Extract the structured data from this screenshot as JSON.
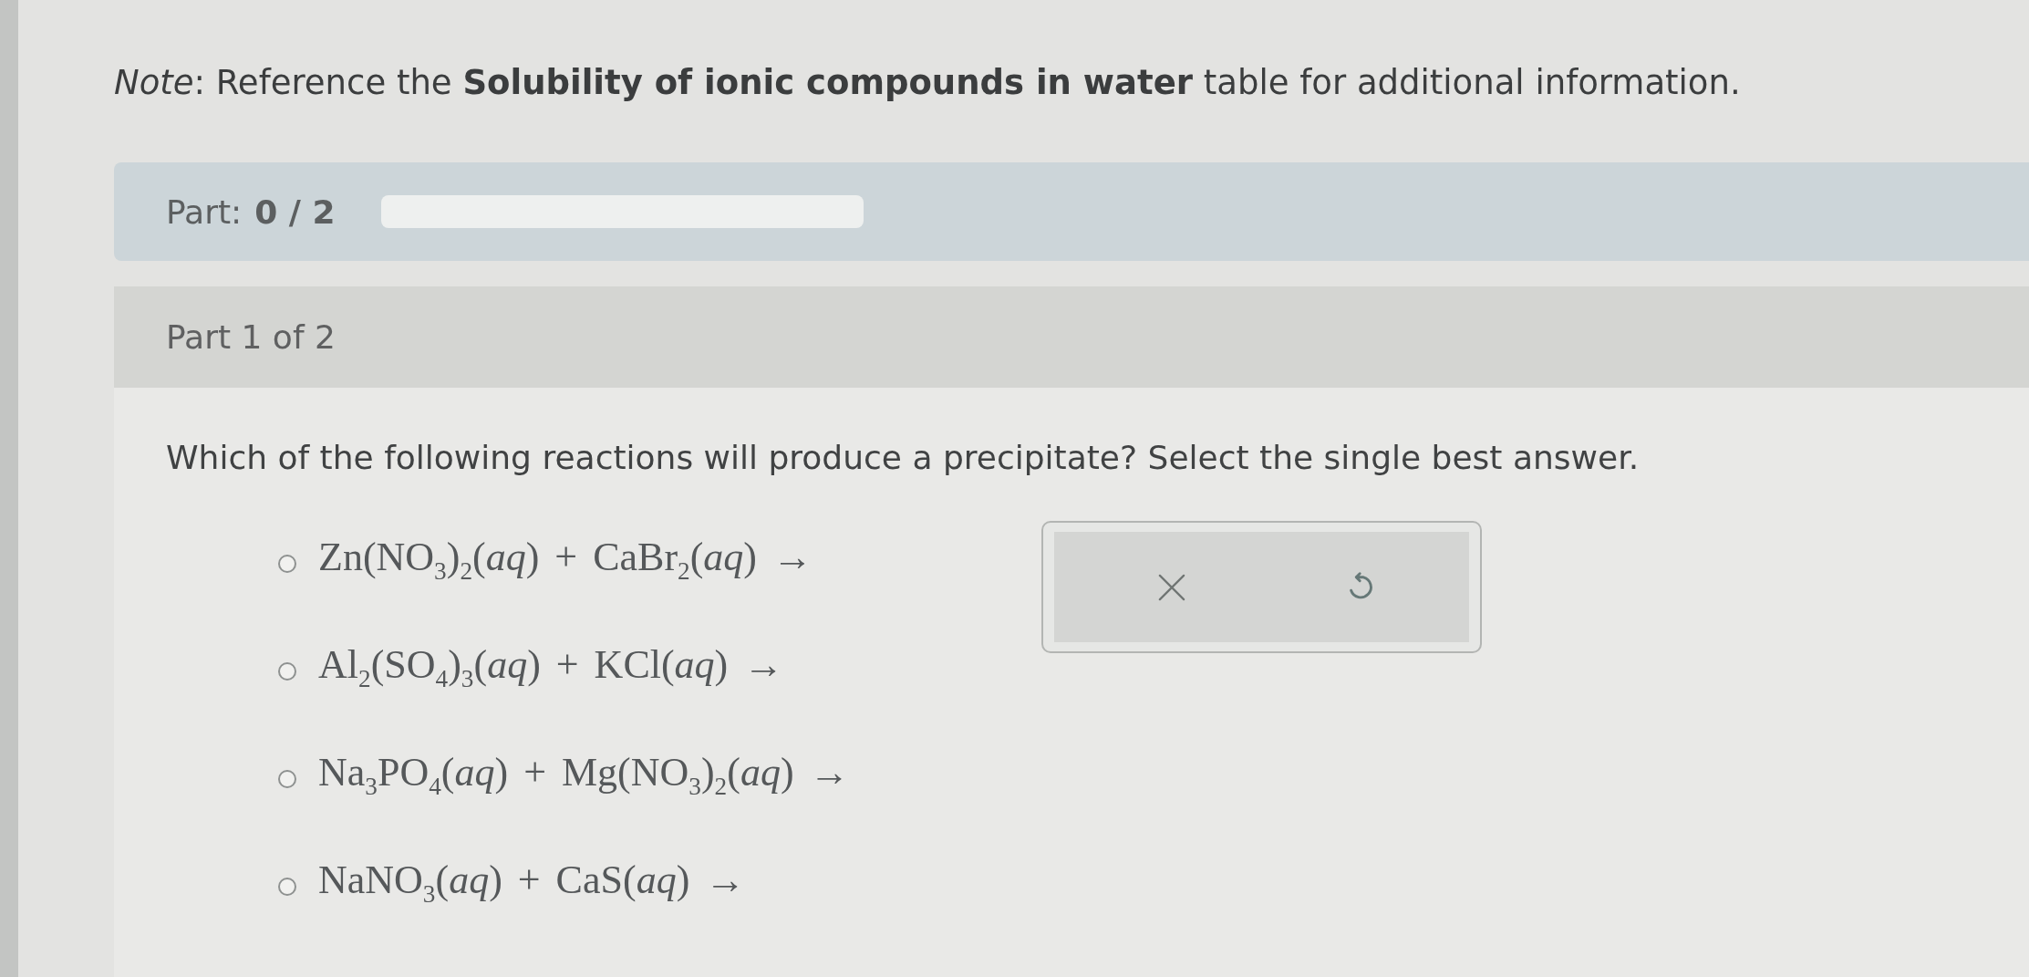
{
  "note": "*Note*: Reference the **Solubility of ionic compounds in water** table for additional information.",
  "progress": {
    "label": "Part:",
    "value": "0 / 2",
    "level": 0
  },
  "part_header": "Part 1 of 2",
  "question": "Which of the following reactions will produce a precipitate? Select the single best answer.",
  "options": [
    {
      "formula": "Zn(NO$_{3}$)$_{2}$(*aq*) + CaBr$_{2}$(*aq*) →",
      "selected": false
    },
    {
      "formula": "Al$_{2}$(SO$_{4}$)$_{3}$(*aq*) + KCl(*aq*) →",
      "selected": false
    },
    {
      "formula": "Na$_{3}$PO$_{4}$(*aq*) + Mg(NO$_{3}$)$_{2}$(*aq*) →",
      "selected": false
    },
    {
      "formula": "NaNO$_{3}$(*aq*) + CaS(*aq*) →",
      "selected": false
    }
  ]
}
